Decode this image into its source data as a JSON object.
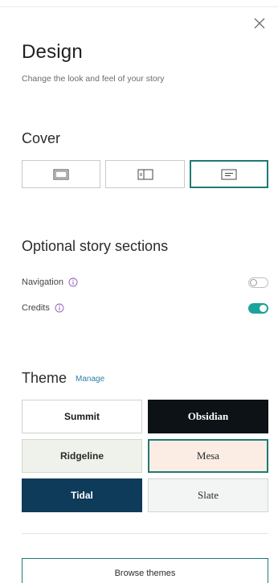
{
  "panel": {
    "title": "Design",
    "subtitle": "Change the look and feel of your story",
    "close_icon": "close-icon"
  },
  "cover": {
    "heading": "Cover",
    "options": [
      {
        "icon": "cover-full-icon",
        "selected": false
      },
      {
        "icon": "cover-split-icon",
        "selected": false
      },
      {
        "icon": "cover-minimal-icon",
        "selected": true
      }
    ],
    "accent_color": "#1f7a74"
  },
  "optional_sections": {
    "heading": "Optional story sections",
    "items": [
      {
        "label": "Navigation",
        "info_icon": "info-icon",
        "enabled": false
      },
      {
        "label": "Credits",
        "info_icon": "info-icon",
        "enabled": true
      }
    ],
    "toggle_on_color": "#1aa39a"
  },
  "theme": {
    "heading": "Theme",
    "manage_label": "Manage",
    "tiles": [
      {
        "name": "Summit",
        "background": "#ffffff",
        "text_color": "#1a1a1a",
        "selected": false
      },
      {
        "name": "Obsidian",
        "background": "#0d1216",
        "text_color": "#ffffff",
        "selected": false
      },
      {
        "name": "Ridgeline",
        "background": "#eef2ea",
        "text_color": "#2b2b2b",
        "selected": false
      },
      {
        "name": "Mesa",
        "background": "#fbede4",
        "text_color": "#2b2b2b",
        "selected": true
      },
      {
        "name": "Tidal",
        "background": "#0f3b5a",
        "text_color": "#ffffff",
        "selected": false
      },
      {
        "name": "Slate",
        "background": "#f3f4f4",
        "text_color": "#2b2b2b",
        "selected": false
      }
    ],
    "browse_label": "Browse themes"
  }
}
